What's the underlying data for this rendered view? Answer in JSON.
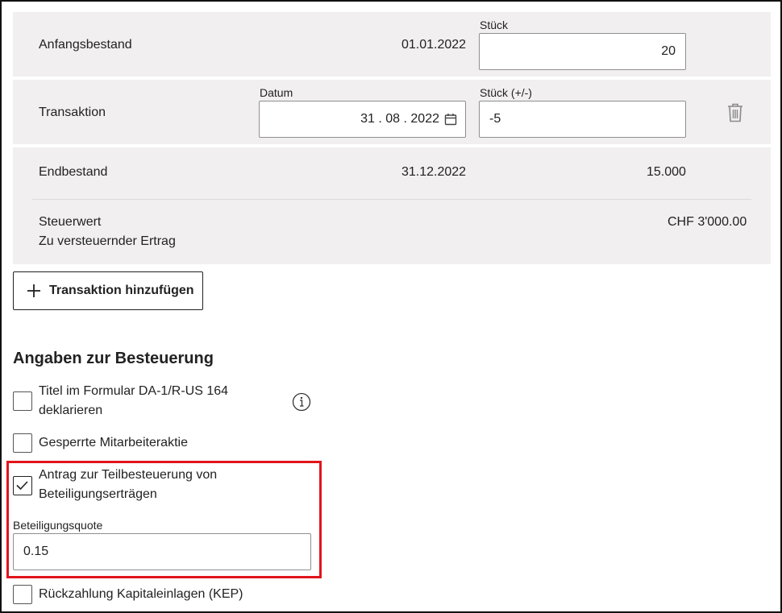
{
  "rows": {
    "anfangsbestand": {
      "label": "Anfangsbestand",
      "date": "01.01.2022",
      "stueck_label": "Stück",
      "stueck_value": "20"
    },
    "transaktion": {
      "label": "Transaktion",
      "datum_label": "Datum",
      "datum_value": "31 . 08 . 2022",
      "stueck_label": "Stück (+/-)",
      "stueck_value": "-5",
      "delete_icon": "trash-icon"
    },
    "endbestand": {
      "label": "Endbestand",
      "date": "31.12.2022",
      "stueck_value": "15.000",
      "steuerwert_label": "Steuerwert",
      "ertrag_label": "Zu versteuernder Ertrag",
      "steuerwert_value": "CHF 3'000.00"
    }
  },
  "add_button": {
    "label": "Transaktion hinzufügen",
    "icon": "plus-icon"
  },
  "taxation": {
    "heading": "Angaben zur Besteuerung",
    "options": [
      {
        "label": "Titel im Formular DA-1/R-US 164 deklarieren",
        "checked": false,
        "info_icon": "info-icon"
      },
      {
        "label": "Gesperrte Mitarbeiteraktie",
        "checked": false
      },
      {
        "label": "Antrag zur Teilbesteuerung von Beteiligungserträgen",
        "checked": true
      },
      {
        "label": "Rückzahlung Kapitaleinlagen (KEP)",
        "checked": false
      }
    ],
    "beteiligungsquote": {
      "label": "Beteiligungsquote",
      "value": "0.15"
    }
  },
  "colors": {
    "panel": "#f1efef",
    "highlight": "#e2141b",
    "border": "#8f8f8f"
  }
}
